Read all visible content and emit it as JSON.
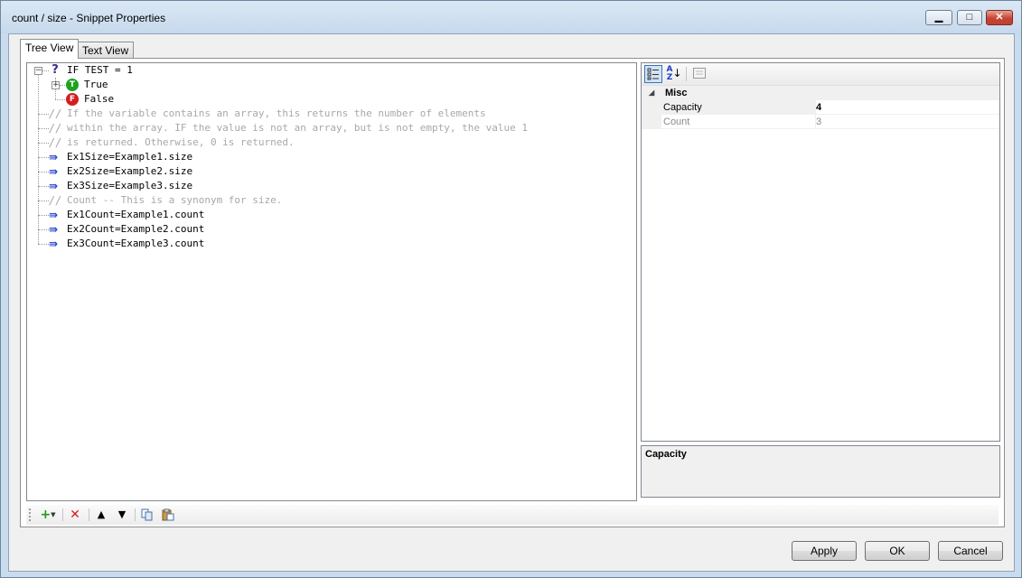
{
  "window": {
    "title": "count / size - Snippet Properties"
  },
  "tabs": [
    {
      "label": "Tree View"
    },
    {
      "label": "Text View"
    }
  ],
  "tree": {
    "root": "IF TEST = 1",
    "true_label": "True",
    "false_label": "False",
    "comment_lines": [
      "If the variable contains an array, this returns the number of elements",
      "within the array. IF the value is not an array, but is not empty, the value 1",
      "is returned. Otherwise, 0 is returned."
    ],
    "size_statements": [
      "Ex1Size=Example1.size",
      "Ex2Size=Example2.size",
      "Ex3Size=Example3.size"
    ],
    "count_comment": "Count -- This is a synonym for size.",
    "count_statements": [
      "Ex1Count=Example1.count",
      "Ex2Count=Example2.count",
      "Ex3Count=Example3.count"
    ],
    "icons": {
      "condition": "question-mark-icon",
      "true_branch": "T",
      "false_branch": "F",
      "comment": "//",
      "statement": "⇛"
    }
  },
  "property_grid": {
    "category": "Misc",
    "rows": [
      {
        "name": "Capacity",
        "value": "4"
      },
      {
        "name": "Count",
        "value": "3"
      }
    ],
    "description_title": "Capacity"
  },
  "buttons": {
    "apply": "Apply",
    "ok": "OK",
    "cancel": "Cancel"
  },
  "colors": {
    "accent": "#3d74b8",
    "true": "#1ea21e",
    "false": "#d41e1e",
    "statement_arrow": "#1b3fcf"
  }
}
